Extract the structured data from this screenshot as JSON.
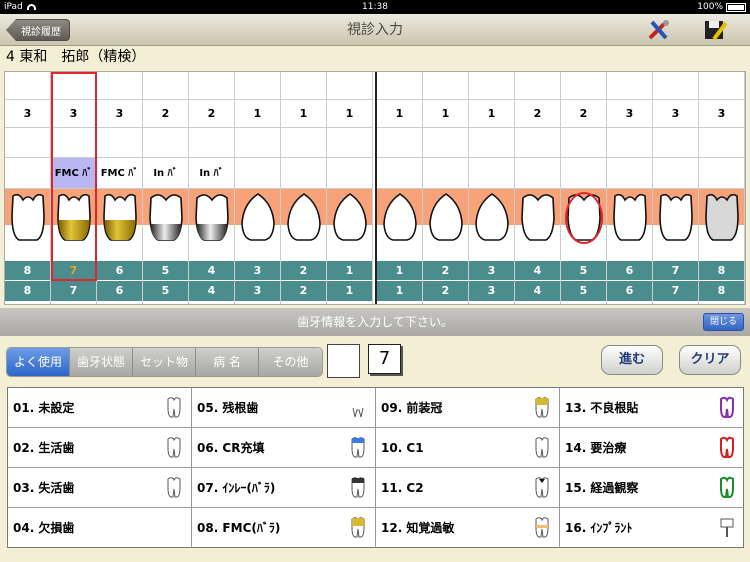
{
  "status": {
    "device": "iPad",
    "time": "11:38",
    "battery": "100%"
  },
  "nav": {
    "back_label": "視診履歴",
    "title": "視診入力"
  },
  "patient": {
    "label": "4 東和　拓郎（精検）"
  },
  "teeth": {
    "left": [
      {
        "mob": "3",
        "trt": "",
        "n1": "8",
        "n2": "8",
        "kind": "molar",
        "crown": "none",
        "hl": false
      },
      {
        "mob": "3",
        "trt": "FMC ﾊﾞ",
        "n1": "7",
        "n2": "7",
        "kind": "molar",
        "crown": "gold",
        "hl": true
      },
      {
        "mob": "3",
        "trt": "FMC ﾊﾞ",
        "n1": "6",
        "n2": "6",
        "kind": "molar",
        "crown": "gold",
        "hl": false
      },
      {
        "mob": "2",
        "trt": "In ﾊﾞ",
        "n1": "5",
        "n2": "5",
        "kind": "premolar",
        "crown": "silver",
        "hl": false
      },
      {
        "mob": "2",
        "trt": "In ﾊﾞ",
        "n1": "4",
        "n2": "4",
        "kind": "premolar",
        "crown": "silver",
        "hl": false
      },
      {
        "mob": "1",
        "trt": "",
        "n1": "3",
        "n2": "3",
        "kind": "anterior",
        "crown": "none",
        "hl": false
      },
      {
        "mob": "1",
        "trt": "",
        "n1": "2",
        "n2": "2",
        "kind": "anterior",
        "crown": "none",
        "hl": false
      },
      {
        "mob": "1",
        "trt": "",
        "n1": "1",
        "n2": "1",
        "kind": "anterior",
        "crown": "none",
        "hl": false
      }
    ],
    "right": [
      {
        "mob": "1",
        "trt": "",
        "n1": "1",
        "n2": "1",
        "kind": "anterior",
        "crown": "none",
        "hl": false
      },
      {
        "mob": "1",
        "trt": "",
        "n1": "2",
        "n2": "2",
        "kind": "anterior",
        "crown": "none",
        "hl": false
      },
      {
        "mob": "1",
        "trt": "",
        "n1": "3",
        "n2": "3",
        "kind": "anterior",
        "crown": "none",
        "hl": false
      },
      {
        "mob": "2",
        "trt": "",
        "n1": "4",
        "n2": "4",
        "kind": "premolar",
        "crown": "none",
        "hl": false
      },
      {
        "mob": "2",
        "trt": "",
        "n1": "5",
        "n2": "5",
        "kind": "premolar",
        "crown": "circle",
        "hl": false
      },
      {
        "mob": "3",
        "trt": "",
        "n1": "6",
        "n2": "6",
        "kind": "molar",
        "crown": "none",
        "hl": false
      },
      {
        "mob": "3",
        "trt": "",
        "n1": "7",
        "n2": "7",
        "kind": "molar",
        "crown": "none",
        "hl": false
      },
      {
        "mob": "3",
        "trt": "",
        "n1": "8",
        "n2": "8",
        "kind": "molar",
        "crown": "grey",
        "hl": false
      }
    ]
  },
  "message": {
    "text": "歯牙情報を入力して下さい。",
    "close_label": "閉じる"
  },
  "tabs": [
    {
      "label": "よく使用",
      "active": true
    },
    {
      "label": "歯牙状態",
      "active": false
    },
    {
      "label": "セット物",
      "active": false
    },
    {
      "label": "病 名",
      "active": false
    },
    {
      "label": "その他",
      "active": false
    }
  ],
  "selected_number": "7",
  "buttons": {
    "next_label": "進む",
    "clear_label": "クリア"
  },
  "options": [
    [
      "01. 未設定",
      "05. 残根歯",
      "09. 前装冠",
      "13. 不良根貼"
    ],
    [
      "02. 生活歯",
      "06. CR充填",
      "10. C1",
      "14. 要治療"
    ],
    [
      "03. 失活歯",
      "07. ｲﾝﾚｰ(ﾊﾞﾗ)",
      "11. C2",
      "15. 経過観察"
    ],
    [
      "04. 欠損歯",
      "08. FMC(ﾊﾞﾗ)",
      "12. 知覚過敏",
      "16. ｲﾝﾌﾟﾗﾝﾄ"
    ]
  ],
  "option_icons": [
    [
      "tooth-outline-icon",
      "root-remnant-icon",
      "veneer-crown-icon",
      "bad-root-icon"
    ],
    [
      "vital-tooth-icon",
      "cr-filling-icon",
      "c1-caries-icon",
      "needs-treatment-icon"
    ],
    [
      "nonvital-tooth-icon",
      "inlay-icon",
      "c2-caries-icon",
      "observation-icon"
    ],
    [
      "",
      "fmc-crown-icon",
      "hypersensitivity-icon",
      "implant-icon"
    ]
  ],
  "colors": {
    "gum": "#f8a27a",
    "number_bar": "#4b8c8c",
    "selected": "#e0252b",
    "active_tab": "#2d64c8"
  }
}
